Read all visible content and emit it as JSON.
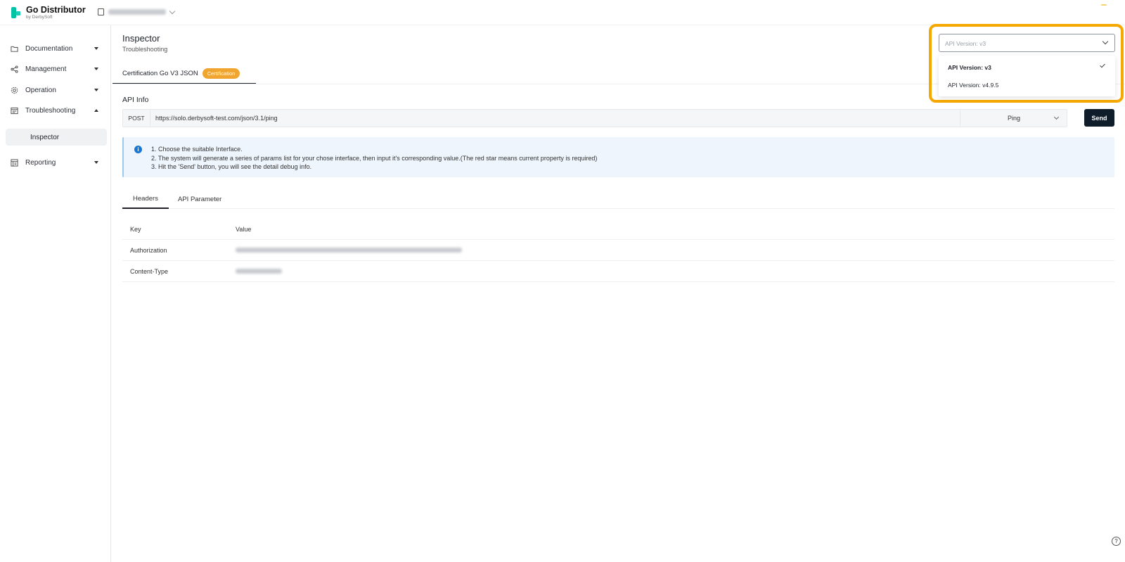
{
  "app": {
    "name": "Go Distributor",
    "by": "by DerbySoft"
  },
  "tenant": {
    "name": "TESTDOLDER99"
  },
  "sidebar": {
    "items": [
      {
        "label": "Documentation",
        "icon": "folder-icon"
      },
      {
        "label": "Management",
        "icon": "share-icon"
      },
      {
        "label": "Operation",
        "icon": "gear-icon"
      },
      {
        "label": "Troubleshooting",
        "icon": "monitor-icon",
        "expanded": true
      },
      {
        "label": "Reporting",
        "icon": "report-icon"
      }
    ],
    "subitems": [
      {
        "label": "Inspector",
        "active": true
      }
    ]
  },
  "page": {
    "title": "Inspector",
    "subtitle": "Troubleshooting"
  },
  "cert_tab": {
    "label": "Certification Go V3 JSON",
    "badge": "Certification",
    "badge_color": "#f0a531"
  },
  "api_info": {
    "heading": "API Info",
    "method": "POST",
    "url": "https://solo.derbysoft-test.com/json/3.1/ping",
    "interface": "Ping",
    "send_label": "Send"
  },
  "info_box": {
    "lines": [
      "1. Choose the suitable Interface.",
      "2. The system will generate a series of params list for your chose interface, then input it's corresponding value.(The red star means current property is required)",
      "3. Hit the 'Send' button, you will see the detail debug info."
    ]
  },
  "sub_tabs": [
    {
      "label": "Headers",
      "active": true
    },
    {
      "label": "API Parameter"
    }
  ],
  "table": {
    "columns": [
      "Key",
      "Value"
    ],
    "rows": [
      {
        "key": "Authorization",
        "value": ""
      },
      {
        "key": "Content-Type",
        "value": ""
      }
    ]
  },
  "version_select": {
    "placeholder": "API Version: v3",
    "options": [
      {
        "label": "API Version: v3",
        "selected": true
      },
      {
        "label": "API Version: v4.9.5",
        "selected": false
      }
    ],
    "highlight_color": "#f5a800"
  },
  "help": {
    "label": "?"
  }
}
